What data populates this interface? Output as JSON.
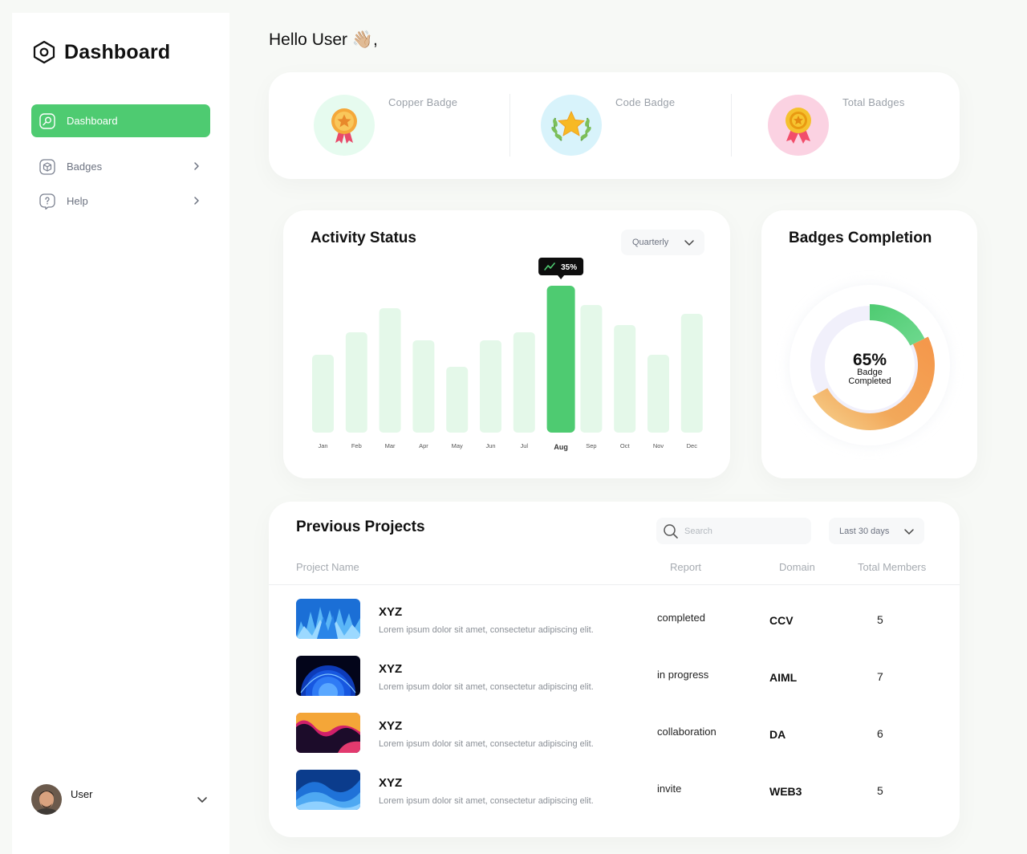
{
  "sidebar": {
    "brand": "Dashboard",
    "items": [
      {
        "label": "Dashboard",
        "icon": "search-icon",
        "active": true
      },
      {
        "label": "Badges",
        "icon": "cube-icon",
        "active": false
      },
      {
        "label": "Help",
        "icon": "help-icon",
        "active": false
      }
    ],
    "user": {
      "name": "User"
    }
  },
  "header": {
    "greeting": "Hello User 👋🏼,"
  },
  "badges": [
    {
      "label": "Copper Badge",
      "icon": "medal-icon",
      "bg": "#e6fbef"
    },
    {
      "label": "Code  Badge",
      "icon": "laurel-star-icon",
      "bg": "#d8f3fb"
    },
    {
      "label": "Total  Badges",
      "icon": "medal-ribbon-icon",
      "bg": "#fbd2e2"
    }
  ],
  "activity": {
    "title": "Activity Status",
    "period": "Quarterly"
  },
  "chart_data": {
    "type": "bar",
    "categories": [
      "Jan",
      "Feb",
      "Mar",
      "Apr",
      "May",
      "Jun",
      "Jul",
      "Aug",
      "Sep",
      "Oct",
      "Nov",
      "Dec"
    ],
    "values": [
      97,
      125,
      155,
      115,
      82,
      115,
      125,
      183,
      159,
      134,
      97,
      148
    ],
    "highlight_index": 7,
    "highlight_label": "35%",
    "bar_color": "#e4f8e9",
    "highlight_color": "#4ecb71"
  },
  "completion": {
    "title": "Badges Completion",
    "percent_label": "65%",
    "sub_line1": "Badge",
    "sub_line2": "Completed",
    "value": 0.65
  },
  "projects": {
    "title": "Previous Projects",
    "search_placeholder": "Search",
    "range": "Last 30 days",
    "columns": [
      "Project Name",
      "Report",
      "Domain",
      "Total Members"
    ],
    "rows": [
      {
        "name": "XYZ",
        "desc": "Lorem ipsum dolor sit amet, consectetur adipiscing elit.",
        "report": "completed",
        "domain": "CCV",
        "members": "5"
      },
      {
        "name": "XYZ",
        "desc": "Lorem ipsum dolor sit amet, consectetur adipiscing elit.",
        "report": "in progress",
        "domain": "AIML",
        "members": "7"
      },
      {
        "name": "XYZ",
        "desc": "Lorem ipsum dolor sit amet, consectetur adipiscing elit.",
        "report": "collaboration",
        "domain": "DA",
        "members": "6"
      },
      {
        "name": "XYZ",
        "desc": "Lorem ipsum dolor sit amet, consectetur adipiscing elit.",
        "report": "invite",
        "domain": "WEB3",
        "members": "5"
      }
    ]
  }
}
